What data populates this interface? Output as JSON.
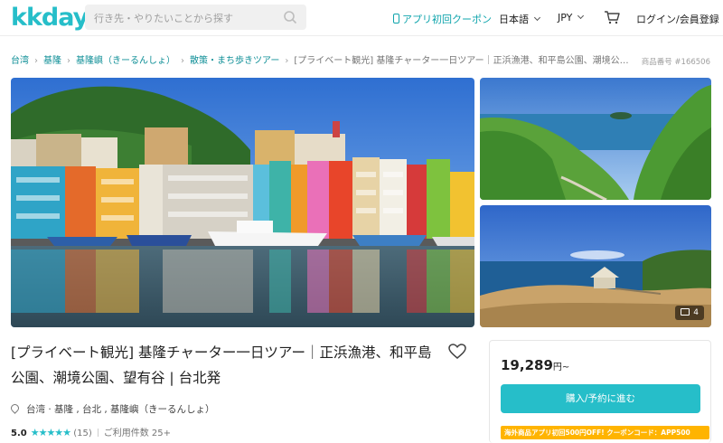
{
  "header": {
    "logo": "kkday",
    "search_placeholder": "行き先・やりたいことから探す",
    "app_coupon": "アプリ初回クーポン",
    "language": "日本語",
    "currency": "JPY",
    "login": "ログイン/会員登録",
    "accent_color": "#26bec9"
  },
  "breadcrumb": {
    "items": [
      "台湾",
      "基隆",
      "基隆嶼（きーるんしょ）",
      "散策・まち歩きツアー"
    ],
    "current": "[プライベート観光] 基隆チャーター一日ツアー｜正浜漁港、和平島公園、潮境公…",
    "product_no": "商品番号 #166506"
  },
  "gallery": {
    "photo_count": "4"
  },
  "product": {
    "title": "[プライベート観光] 基隆チャーター一日ツアー｜正浜漁港、和平島公園、潮境公園、望有谷 | 台北発",
    "location": "台湾 · 基隆 , 台北 , 基隆嶼（きーるんしょ）",
    "rating": "5.0",
    "stars": "★★★★★",
    "review_count": "(15)",
    "usage_count": "ご利用件数 25+"
  },
  "booking": {
    "price": "19,289",
    "price_unit": "円~",
    "button_label": "購入/予約に進む",
    "promo": "海外商品アプリ初回500円OFF! クーポンコード：APP500"
  }
}
